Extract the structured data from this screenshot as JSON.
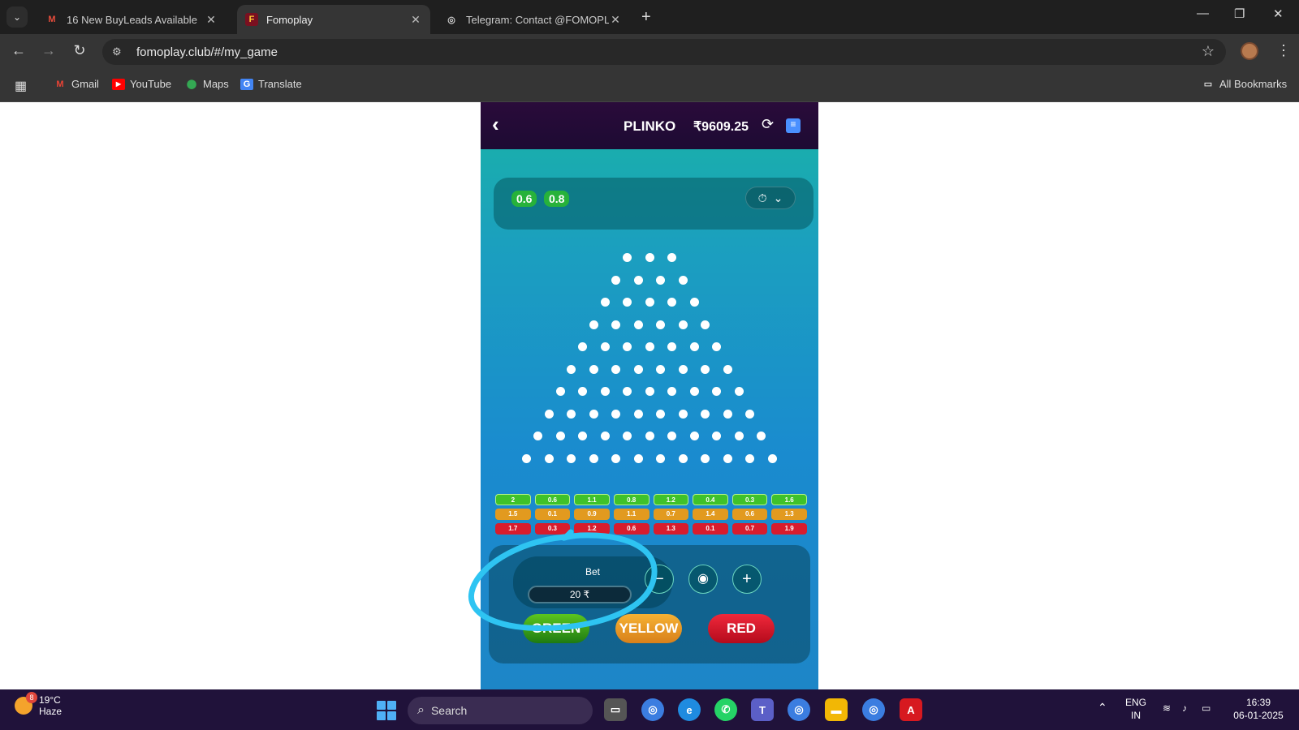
{
  "browser": {
    "tabs": [
      {
        "label": "16 New BuyLeads Available",
        "favicon": "M"
      },
      {
        "label": "Fomoplay",
        "favicon": "F"
      },
      {
        "label": "Telegram: Contact @FOMOPLAY",
        "favicon": "globe"
      }
    ],
    "url": "fomoplay.club/#/my_game",
    "bookmarks": [
      {
        "label": "Gmail",
        "icon": "gmail-icon"
      },
      {
        "label": "YouTube",
        "icon": "youtube-icon"
      },
      {
        "label": "Maps",
        "icon": "maps-icon"
      },
      {
        "label": "Translate",
        "icon": "translate-icon"
      }
    ],
    "all_bookmarks": "All Bookmarks"
  },
  "game": {
    "title": "PLINKO",
    "balance": "₹9609.25",
    "history": [
      "0.6",
      "0.8"
    ],
    "multipliers": {
      "green": [
        "2",
        "0.6",
        "1.1",
        "0.8",
        "1.2",
        "0.4",
        "0.3",
        "1.6"
      ],
      "yellow": [
        "1.5",
        "0.1",
        "0.9",
        "1.1",
        "0.7",
        "1.4",
        "0.6",
        "1.3"
      ],
      "red": [
        "1.7",
        "0.3",
        "1.2",
        "0.6",
        "1.3",
        "0.1",
        "0.7",
        "1.9"
      ]
    },
    "bet_label": "Bet",
    "bet_value": "20 ₹",
    "buttons": {
      "green": "GREEN",
      "yellow": "YELLOW",
      "red": "RED"
    },
    "colors": {
      "green": "#27b23a",
      "yellow": "#e29a1f",
      "red": "#d81c2d",
      "annotation": "#2ec4f2"
    }
  },
  "taskbar": {
    "temp": "19°C",
    "condition": "Haze",
    "weather_badge": "8",
    "search_placeholder": "Search",
    "lang_1": "ENG",
    "lang_2": "IN",
    "time": "16:39",
    "date": "06-01-2025"
  }
}
